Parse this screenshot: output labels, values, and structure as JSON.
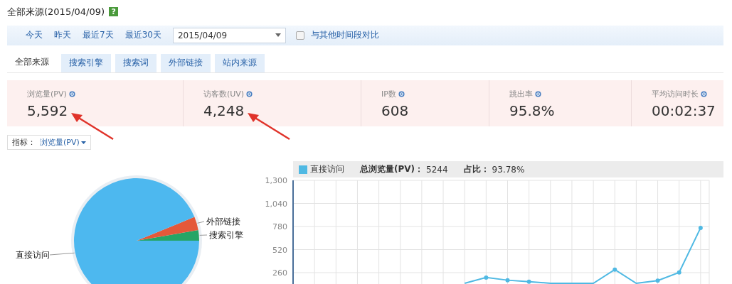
{
  "header": {
    "title": "全部来源(2015/04/09)",
    "help": "?"
  },
  "filter_bar": {
    "quick_ranges": [
      "今天",
      "昨天",
      "最近7天",
      "最近30天"
    ],
    "date": "2015/04/09",
    "compare": {
      "label": "与其他时间段对比",
      "checked": false
    }
  },
  "tabs": [
    {
      "label": "全部来源",
      "selected": true
    },
    {
      "label": "搜索引擎",
      "selected": false
    },
    {
      "label": "搜索词",
      "selected": false
    },
    {
      "label": "外部链接",
      "selected": false
    },
    {
      "label": "站内来源",
      "selected": false
    }
  ],
  "metrics": [
    {
      "label": "浏览量(PV)",
      "value": "5,592",
      "annotated": true
    },
    {
      "label": "访客数(UV)",
      "value": "4,248",
      "annotated": true
    },
    {
      "label": "IP数",
      "value": "608",
      "annotated": false
    },
    {
      "label": "跳出率",
      "value": "95.8%",
      "annotated": false
    },
    {
      "label": "平均访问时长",
      "value": "00:02:37",
      "annotated": false
    }
  ],
  "indicator": {
    "label": "指标：",
    "value": "浏览量(PV)"
  },
  "pie": {
    "chart_data": {
      "type": "pie",
      "categories": [
        "直接访问",
        "外部链接",
        "搜索引擎"
      ],
      "values": [
        93.78,
        3.5,
        2.72
      ]
    }
  },
  "line": {
    "legend": {
      "total_label": "总浏览量(PV)：",
      "total": "5244",
      "share_label": "占比：",
      "share": "93.78%"
    },
    "chart_data": {
      "type": "line",
      "grid": true,
      "ylim": [
        0,
        1300
      ],
      "yticks": [
        {
          "value": 1300,
          "label": "1,300"
        },
        {
          "value": 1040,
          "label": "1,040"
        },
        {
          "value": 780,
          "label": "780"
        },
        {
          "value": 520,
          "label": "520"
        },
        {
          "value": 260,
          "label": "260"
        }
      ],
      "series": [
        {
          "name": "直接访问",
          "color": "#4fb9e3",
          "values": [
            null,
            null,
            null,
            null,
            null,
            null,
            null,
            null,
            140,
            205,
            175,
            158,
            140,
            140,
            140,
            295,
            140,
            170,
            262,
            765
          ]
        }
      ]
    }
  }
}
